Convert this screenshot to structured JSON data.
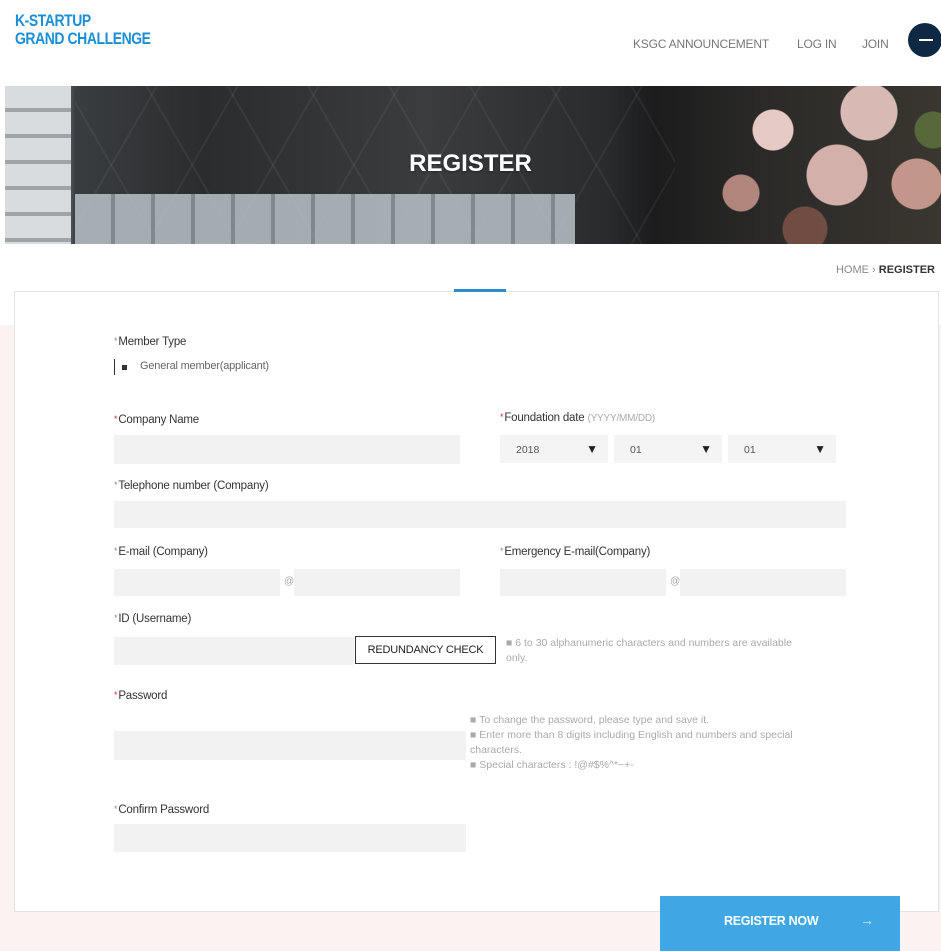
{
  "brand": {
    "line1": "K-STARTUP",
    "line2": "GRAND CHALLENGE",
    "color": "#1a8fd6"
  },
  "nav": {
    "announcement": "KSGC ANNOUNCEMENT",
    "login": "LOG IN",
    "join": "JOIN",
    "menu_icon": "hamburger-icon"
  },
  "hero": {
    "title": "REGISTER"
  },
  "breadcrumb": {
    "home": "HOME",
    "sep": "›",
    "current": "REGISTER"
  },
  "form": {
    "member_type": {
      "label": "Member Type",
      "marker": "*",
      "option": "General member(applicant)"
    },
    "company_name": {
      "label": "Company Name",
      "marker": "*"
    },
    "foundation_date": {
      "label": "Foundation date",
      "marker": "*",
      "hint": "(YYYY/MM/DD)",
      "year": "2018",
      "month": "01",
      "day": "01"
    },
    "telephone": {
      "label": "Telephone number (Company)",
      "marker": "*"
    },
    "email": {
      "label": "E-mail (Company)",
      "marker": "*",
      "at": "@"
    },
    "emergency_email": {
      "label": "Emergency E-mail(Company)",
      "marker": "*",
      "at": "@"
    },
    "username": {
      "label": "ID (Username)",
      "marker": "*",
      "check_button": "REDUNDANCY CHECK",
      "hint": "■ 6 to 30 alphanumeric characters and numbers are available only."
    },
    "password": {
      "label": "Password",
      "marker": "*",
      "hint1": "■ To change the password, please type and save it.",
      "hint2": "■ Enter more than 8 digits including English and numbers and special characters.",
      "hint3": "■ Special characters : !@#$%^*~+-"
    },
    "confirm_password": {
      "label": "Confirm Password",
      "marker": "*"
    }
  },
  "submit": {
    "label": "REGISTER NOW",
    "arrow": "→",
    "color": "#41a7e4"
  }
}
